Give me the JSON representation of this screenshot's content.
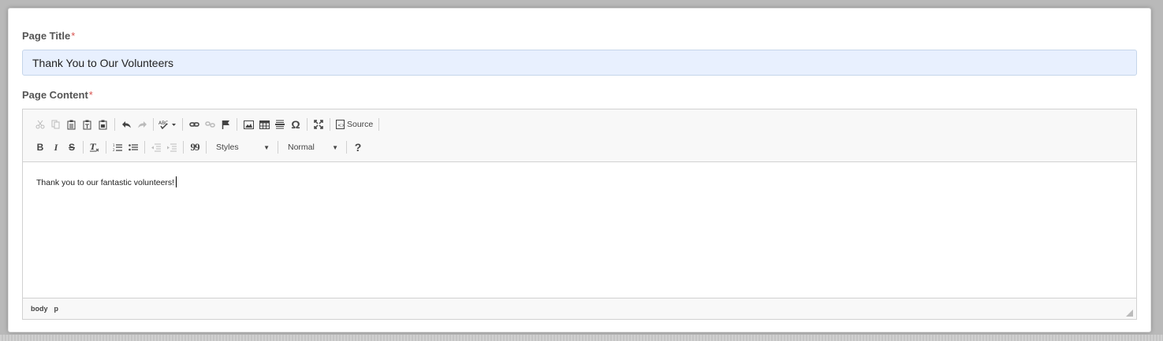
{
  "form": {
    "title_label": "Page Title",
    "title_required": "*",
    "title_value": "Thank You to Our Volunteers",
    "content_label": "Page Content",
    "content_required": "*"
  },
  "toolbar": {
    "row1": [
      {
        "icon": "cut-icon",
        "enabled": false
      },
      {
        "icon": "copy-icon",
        "enabled": false
      },
      {
        "icon": "paste-icon",
        "enabled": true
      },
      {
        "icon": "paste-text-icon",
        "enabled": true
      },
      {
        "icon": "paste-word-icon",
        "enabled": true
      },
      {
        "icon": "undo-icon",
        "enabled": true
      },
      {
        "icon": "redo-icon",
        "enabled": false
      },
      {
        "icon": "spellcheck-icon",
        "enabled": true
      },
      {
        "icon": "link-icon",
        "enabled": true
      },
      {
        "icon": "unlink-icon",
        "enabled": false
      },
      {
        "icon": "anchor-icon",
        "enabled": true
      },
      {
        "icon": "image-icon",
        "enabled": true
      },
      {
        "icon": "table-icon",
        "enabled": true
      },
      {
        "icon": "horizontal-rule-icon",
        "enabled": true
      },
      {
        "icon": "special-char-icon",
        "enabled": true
      },
      {
        "icon": "maximize-icon",
        "enabled": true
      },
      {
        "icon": "source-icon",
        "enabled": true
      }
    ],
    "source_label": "Source",
    "bold_label": "B",
    "italic_label": "I",
    "strike_label": "S",
    "special_char_label": "Ω",
    "blockquote_label": "99",
    "help_label": "?",
    "styles_label": "Styles",
    "format_label": "Normal"
  },
  "editor": {
    "content_text": "Thank you to our fantastic volunteers!"
  },
  "statusbar": {
    "path": [
      "body",
      "p"
    ]
  },
  "colors": {
    "input_bg": "#e8f0fe",
    "required": "#d9534f",
    "toolbar_bg": "#f8f8f8"
  }
}
